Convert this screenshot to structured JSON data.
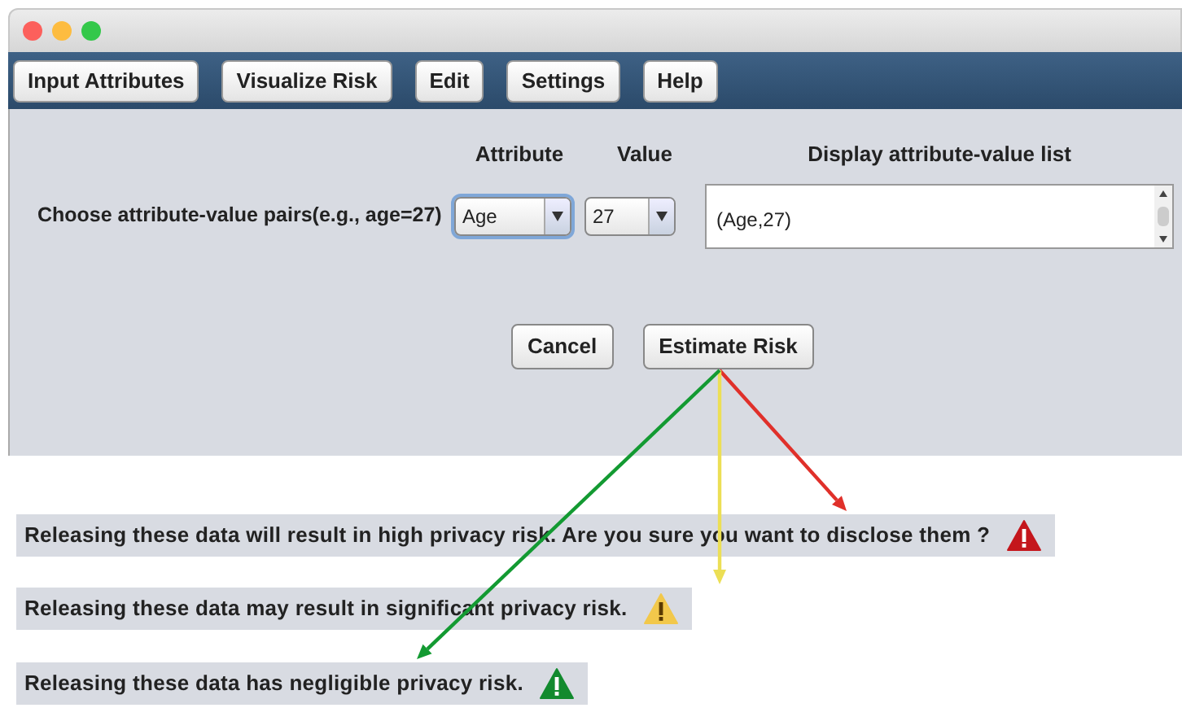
{
  "window": {
    "controls": [
      {
        "kind": "close"
      },
      {
        "kind": "minimize"
      },
      {
        "kind": "zoom"
      }
    ]
  },
  "toolbar": [
    {
      "label": "Input Attributes"
    },
    {
      "label": "Visualize Risk"
    },
    {
      "label": "Edit"
    },
    {
      "label": "Settings"
    },
    {
      "label": "Help"
    }
  ],
  "form": {
    "prompt": "Choose attribute-value pairs(e.g., age=27)",
    "attribute": {
      "heading": "Attribute",
      "value": "Age",
      "focused": true
    },
    "value": {
      "heading": "Value",
      "value": "27",
      "focused": false
    },
    "list": {
      "heading": "Display attribute-value list",
      "entries": [
        "(Age,27)"
      ]
    }
  },
  "buttons": [
    {
      "label": "Cancel"
    },
    {
      "label": "Estimate Risk"
    }
  ],
  "messages": [
    {
      "kind": "high",
      "text": "Releasing these data will result in high privacy risk. Are you sure you want to disclose them ?"
    },
    {
      "kind": "medium",
      "text": "Releasing these data may result in significant privacy risk."
    },
    {
      "kind": "low",
      "text": "Releasing these data has negligible privacy risk."
    }
  ]
}
